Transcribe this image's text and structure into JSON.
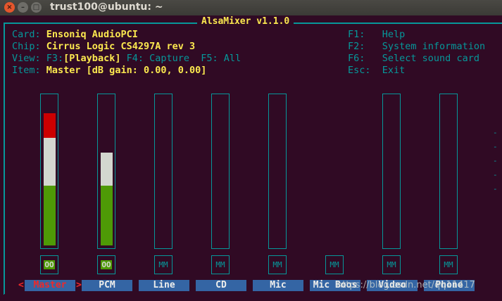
{
  "window": {
    "title": "trust100@ubuntu: ~",
    "close": "×",
    "minimize": "–",
    "maximize": "□"
  },
  "mixer": {
    "title": "AlsaMixer v1.1.0",
    "card_label": "Card:",
    "card_value": "Ensoniq AudioPCI",
    "chip_label": "Chip:",
    "chip_value": "Cirrus Logic CS4297A rev 3",
    "view_label": "View:",
    "view_f3": "F3:",
    "view_playback": "[Playback]",
    "view_f4": "F4: Capture",
    "view_f5": "F5: All",
    "item_label": "Item:",
    "item_value": "Master [dB gain: 0.00, 0.00]"
  },
  "keys": [
    {
      "key": "F1:",
      "action": "Help"
    },
    {
      "key": "F2:",
      "action": "System information"
    },
    {
      "key": "F6:",
      "action": "Select sound card"
    },
    {
      "key": "Esc:",
      "action": "Exit"
    }
  ],
  "channels": [
    {
      "name": "Master",
      "left": "100",
      "arrows": "<>",
      "right": "100",
      "mute": "OO",
      "level": 100,
      "selected": true
    },
    {
      "name": "PCM",
      "left": "70",
      "arrows": "<>",
      "right": "70",
      "mute": "OO",
      "level": 70
    },
    {
      "name": "Line",
      "left": "0",
      "arrows": "<>",
      "right": "0",
      "mute": "MM",
      "level": 0
    },
    {
      "name": "CD",
      "left": "0",
      "arrows": "<>",
      "right": "0",
      "mute": "MM",
      "level": 0
    },
    {
      "name": "Mic",
      "left": "0",
      "arrows": "<>",
      "right": "0",
      "mute": "MM",
      "level": 0
    },
    {
      "name": "Mic Boos",
      "mute": "MM"
    },
    {
      "name": "Video",
      "left": "0",
      "arrows": "<>",
      "right": "0",
      "mute": "MM",
      "level": 0
    },
    {
      "name": "Phone",
      "left": "0",
      "arrows": "<>",
      "right": "0",
      "mute": "MM",
      "level": 0
    }
  ],
  "pointer_left": "<",
  "pointer_right": ">",
  "scroll_tick": "-",
  "watermark": "https://blog.csdn.net/qq11417"
}
